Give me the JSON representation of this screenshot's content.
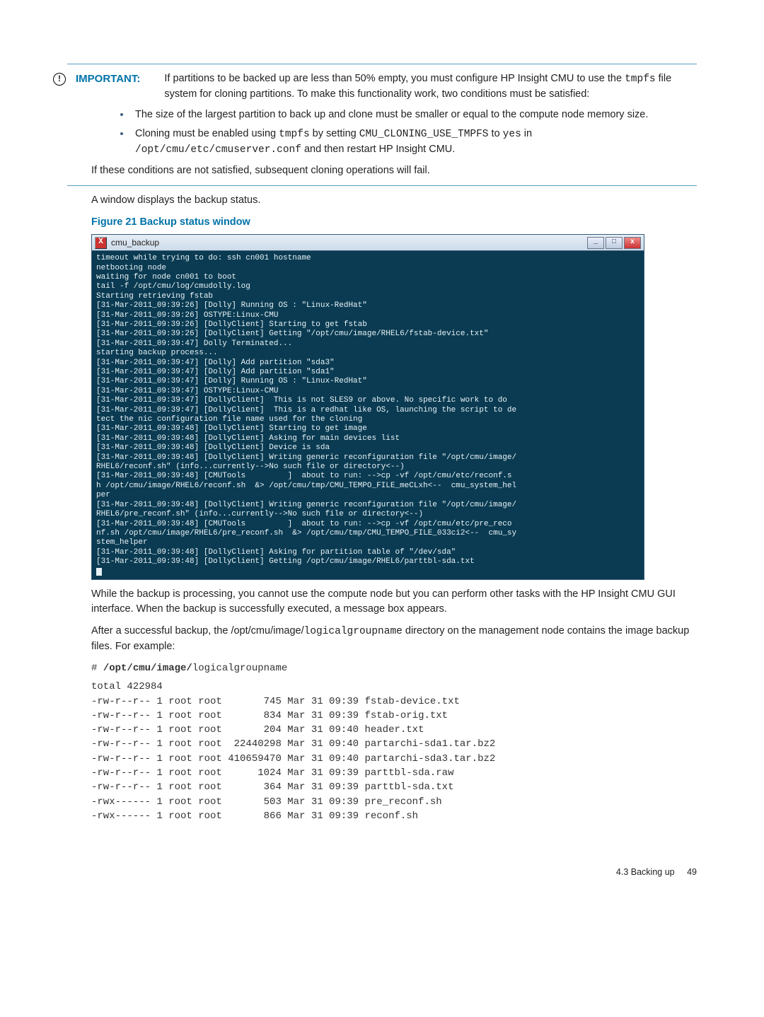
{
  "important": {
    "icon_glyph": "!",
    "label": "IMPORTANT:",
    "lead": "If partitions to be backed up are less than 50% empty, you must configure HP Insight CMU to use the ",
    "code1": "tmpfs",
    "lead2": " file system for cloning partitions. To make this functionality work, two conditions must be satisfied:",
    "b1": "The size of the largest partition to back up and clone must be smaller or equal to the compute node memory size.",
    "b2_a": "Cloning must be enabled using ",
    "b2_tmpfs": "tmpfs",
    "b2_b": " by setting ",
    "b2_var": "CMU_CLONING_USE_TMPFS",
    "b2_c": " to ",
    "b2_yes": "yes",
    "b2_d": " in ",
    "b2_path": "/opt/cmu/etc/cmuserver.conf",
    "b2_e": " and then restart HP Insight CMU.",
    "tail": "If these conditions are not satisfied, subsequent cloning operations will fail."
  },
  "p1": "A window displays the backup status.",
  "fig_title": "Figure 21 Backup status window",
  "term": {
    "title": "cmu_backup",
    "btn_min": "_",
    "btn_max": "□",
    "btn_close": "x",
    "body": "timeout while trying to do: ssh cn001 hostname\nnetbooting node\nwaiting for node cn001 to boot\ntail -f /opt/cmu/log/cmudolly.log\nStarting retrieving fstab\n[31-Mar-2011_09:39:26] [Dolly] Running OS : \"Linux-RedHat\"\n[31-Mar-2011_09:39:26] OSTYPE:Linux-CMU\n[31-Mar-2011_09:39:26] [DollyClient] Starting to get fstab\n[31-Mar-2011_09:39:26] [DollyClient] Getting \"/opt/cmu/image/RHEL6/fstab-device.txt\"\n[31-Mar-2011_09:39:47] Dolly Terminated...\nstarting backup process...\n[31-Mar-2011_09:39:47] [Dolly] Add partition \"sda3\"\n[31-Mar-2011_09:39:47] [Dolly] Add partition \"sda1\"\n[31-Mar-2011_09:39:47] [Dolly] Running OS : \"Linux-RedHat\"\n[31-Mar-2011_09:39:47] OSTYPE:Linux-CMU\n[31-Mar-2011_09:39:47] [DollyClient]  This is not SLES9 or above. No specific work to do\n[31-Mar-2011_09:39:47] [DollyClient]  This is a redhat like OS, launching the script to de\ntect the nic configuration file name used for the cloning\n[31-Mar-2011_09:39:48] [DollyClient] Starting to get image\n[31-Mar-2011_09:39:48] [DollyClient] Asking for main devices list\n[31-Mar-2011_09:39:48] [DollyClient] Device is sda\n[31-Mar-2011_09:39:48] [DollyClient] Writing generic reconfiguration file \"/opt/cmu/image/\nRHEL6/reconf.sh\" (info...currently-->No such file or directory<--)\n[31-Mar-2011_09:39:48] [CMUTools         ]  about to run: -->cp -vf /opt/cmu/etc/reconf.s\nh /opt/cmu/image/RHEL6/reconf.sh  &> /opt/cmu/tmp/CMU_TEMPO_FILE_meCLxh<--  cmu_system_hel\nper\n[31-Mar-2011_09:39:48] [DollyClient] Writing generic reconfiguration file \"/opt/cmu/image/\nRHEL6/pre_reconf.sh\" (info...currently-->No such file or directory<--)\n[31-Mar-2011_09:39:48] [CMUTools         ]  about to run: -->cp -vf /opt/cmu/etc/pre_reco\nnf.sh /opt/cmu/image/RHEL6/pre_reconf.sh  &> /opt/cmu/tmp/CMU_TEMPO_FILE_033ci2<--  cmu_sy\nstem_helper\n[31-Mar-2011_09:39:48] [DollyClient] Asking for partition table of \"/dev/sda\"\n[31-Mar-2011_09:39:48] [DollyClient] Getting /opt/cmu/image/RHEL6/parttbl-sda.txt"
  },
  "p2": "While the backup is processing, you cannot use the compute node but you can perform other tasks with the HP Insight CMU GUI interface. When the backup is successfully executed, a message box appears.",
  "p3a": "After a successful backup, the /opt/cmu/image/",
  "p3code": "logicalgroupname",
  "p3b": " directory on the management node contains the image backup files. For example:",
  "ls_cmd_hash": "# ",
  "ls_cmd_b": "/opt/cmu/image/",
  "ls_cmd_tail": "logicalgroupname",
  "ls_out": "total 422984\n-rw-r--r-- 1 root root       745 Mar 31 09:39 fstab-device.txt\n-rw-r--r-- 1 root root       834 Mar 31 09:39 fstab-orig.txt\n-rw-r--r-- 1 root root       204 Mar 31 09:40 header.txt\n-rw-r--r-- 1 root root  22440298 Mar 31 09:40 partarchi-sda1.tar.bz2\n-rw-r--r-- 1 root root 410659470 Mar 31 09:40 partarchi-sda3.tar.bz2\n-rw-r--r-- 1 root root      1024 Mar 31 09:39 parttbl-sda.raw\n-rw-r--r-- 1 root root       364 Mar 31 09:39 parttbl-sda.txt\n-rwx------ 1 root root       503 Mar 31 09:39 pre_reconf.sh\n-rwx------ 1 root root       866 Mar 31 09:39 reconf.sh",
  "footer_section": "4.3 Backing up",
  "footer_page": "49"
}
